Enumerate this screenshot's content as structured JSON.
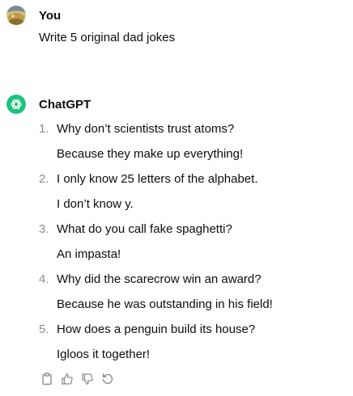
{
  "user_message": {
    "author": "You",
    "text": "Write 5 original dad jokes"
  },
  "assistant_message": {
    "author": "ChatGPT",
    "jokes": [
      {
        "number": "1.",
        "question": "Why don’t scientists trust atoms?",
        "answer": "Because they make up everything!"
      },
      {
        "number": "2.",
        "question": "I only know 25 letters of the alphabet.",
        "answer": "I don’t know y."
      },
      {
        "number": "3.",
        "question": "What do you call fake spaghetti?",
        "answer": "An impasta!"
      },
      {
        "number": "4.",
        "question": "Why did the scarecrow win an award?",
        "answer": "Because he was outstanding in his field!"
      },
      {
        "number": "5.",
        "question": "How does a penguin build its house?",
        "answer": "Igloos it together!"
      }
    ]
  },
  "actions": [
    {
      "icon": "clipboard-icon"
    },
    {
      "icon": "thumbs-up-icon"
    },
    {
      "icon": "thumbs-down-icon"
    },
    {
      "icon": "regenerate-icon"
    }
  ],
  "colors": {
    "text": "#0d0d0d",
    "muted": "#8e8e8e",
    "chatgpt_avatar": "#19c37d"
  }
}
